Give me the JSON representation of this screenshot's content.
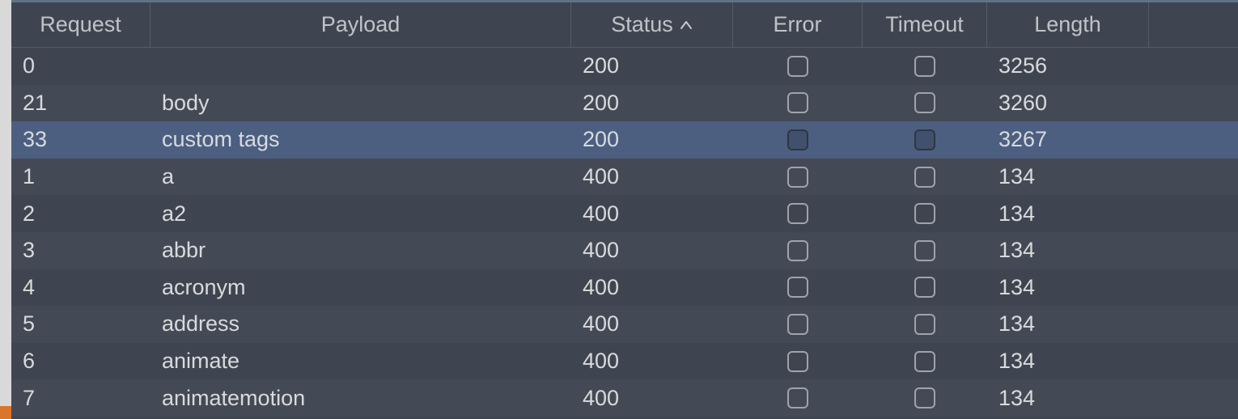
{
  "columns": {
    "request": "Request",
    "payload": "Payload",
    "status": "Status",
    "error": "Error",
    "timeout": "Timeout",
    "length": "Length"
  },
  "sort": {
    "column": "status",
    "direction": "asc"
  },
  "rows": [
    {
      "request": "0",
      "payload": "",
      "status": "200",
      "error": false,
      "timeout": false,
      "length": "3256",
      "alt": false,
      "selected": false
    },
    {
      "request": "21",
      "payload": "body",
      "status": "200",
      "error": false,
      "timeout": false,
      "length": "3260",
      "alt": true,
      "selected": false
    },
    {
      "request": "33",
      "payload": "custom tags",
      "status": "200",
      "error": false,
      "timeout": false,
      "length": "3267",
      "alt": false,
      "selected": true
    },
    {
      "request": "1",
      "payload": "a",
      "status": "400",
      "error": false,
      "timeout": false,
      "length": "134",
      "alt": true,
      "selected": false
    },
    {
      "request": "2",
      "payload": "a2",
      "status": "400",
      "error": false,
      "timeout": false,
      "length": "134",
      "alt": false,
      "selected": false
    },
    {
      "request": "3",
      "payload": "abbr",
      "status": "400",
      "error": false,
      "timeout": false,
      "length": "134",
      "alt": true,
      "selected": false
    },
    {
      "request": "4",
      "payload": "acronym",
      "status": "400",
      "error": false,
      "timeout": false,
      "length": "134",
      "alt": false,
      "selected": false
    },
    {
      "request": "5",
      "payload": "address",
      "status": "400",
      "error": false,
      "timeout": false,
      "length": "134",
      "alt": true,
      "selected": false
    },
    {
      "request": "6",
      "payload": "animate",
      "status": "400",
      "error": false,
      "timeout": false,
      "length": "134",
      "alt": false,
      "selected": false
    },
    {
      "request": "7",
      "payload": "animatemotion",
      "status": "400",
      "error": false,
      "timeout": false,
      "length": "134",
      "alt": true,
      "selected": false
    }
  ]
}
